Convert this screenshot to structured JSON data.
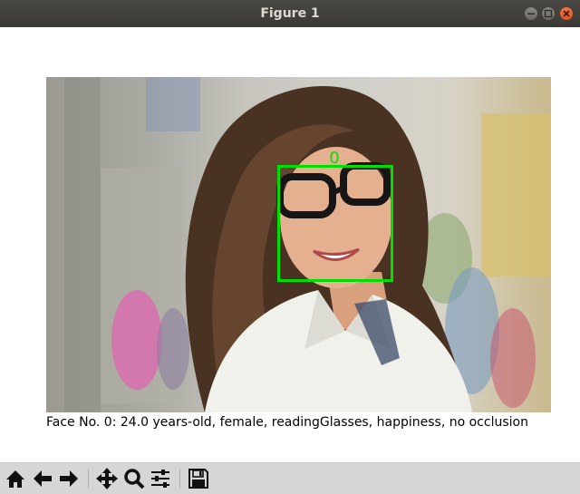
{
  "window": {
    "title": "Figure 1"
  },
  "figure": {
    "face_box_label": "0",
    "box_color": "#00e000",
    "caption": "Face No. 0: 24.0 years-old, female, readingGlasses, happiness, no occlusion"
  },
  "toolbar": {
    "buttons": [
      {
        "name": "home",
        "icon": "home-icon"
      },
      {
        "name": "back",
        "icon": "arrow-left-icon"
      },
      {
        "name": "forward",
        "icon": "arrow-right-icon"
      },
      {
        "name": "pan",
        "icon": "move-icon"
      },
      {
        "name": "zoom",
        "icon": "magnifier-icon"
      },
      {
        "name": "configure-subplots",
        "icon": "sliders-icon"
      },
      {
        "name": "save",
        "icon": "floppy-icon"
      }
    ]
  }
}
